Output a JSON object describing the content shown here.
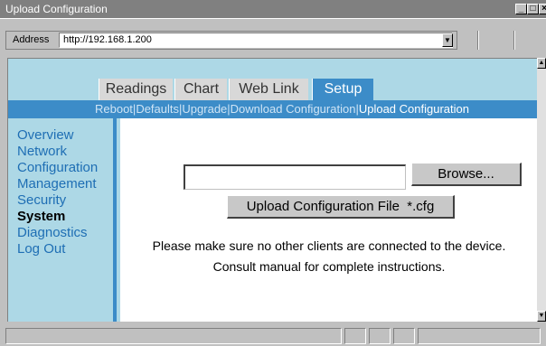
{
  "window": {
    "title": "Upload Configuration",
    "controls": {
      "minimize": "_",
      "maximize": "□",
      "close": "×"
    }
  },
  "address_bar": {
    "label": "Address",
    "url": "http://192.168.1.200"
  },
  "tabs": [
    {
      "label": "Readings",
      "active": false
    },
    {
      "label": "Chart",
      "active": false
    },
    {
      "label": "Web Link",
      "active": false
    },
    {
      "label": "Setup",
      "active": true
    }
  ],
  "subnav": {
    "items": [
      "Reboot",
      "Defaults",
      "Upgrade",
      "Download Configuration",
      "Upload Configuration"
    ],
    "separator": "|",
    "active": "Upload Configuration"
  },
  "sidebar": {
    "items": [
      {
        "label": "Overview",
        "bold": false
      },
      {
        "label": "Network",
        "bold": false
      },
      {
        "label": "Configuration",
        "bold": false
      },
      {
        "label": "Management",
        "bold": false
      },
      {
        "label": "Security",
        "bold": false
      },
      {
        "label": "System",
        "bold": true
      },
      {
        "label": "Diagnostics",
        "bold": false
      },
      {
        "label": "Log Out",
        "bold": false
      }
    ]
  },
  "form": {
    "file_value": "",
    "browse_label": "Browse...",
    "upload_label": "Upload Configuration File  *.cfg"
  },
  "messages": {
    "line1": "Please make sure no other clients are connected to the device.",
    "line2": "Consult manual for complete instructions."
  },
  "colors": {
    "accent": "#3c8cc8",
    "background": "#add8e6",
    "link": "#1e6eb4"
  }
}
